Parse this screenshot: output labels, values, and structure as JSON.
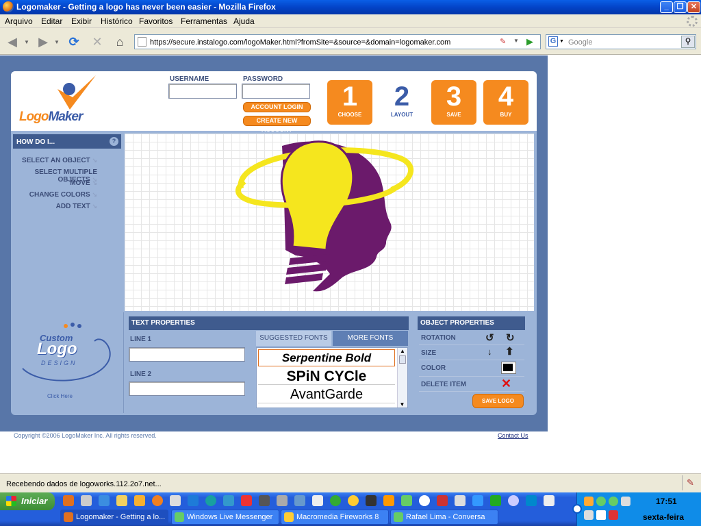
{
  "window": {
    "title": "Logomaker - Getting a logo has never been easier - Mozilla Firefox"
  },
  "menu": [
    "Arquivo",
    "Editar",
    "Exibir",
    "Histórico",
    "Favoritos",
    "Ferramentas",
    "Ajuda"
  ],
  "nav": {
    "url": "https://secure.instalogo.com/logoMaker.html?fromSite=&source=&domain=logomaker.com",
    "search_placeholder": "Google"
  },
  "logomaker": {
    "brand_logo": "LogoMaker",
    "username_label": "USERNAME",
    "password_label": "PASSWORD",
    "username_value": "",
    "password_value": "",
    "account_login": "ACCOUNT LOGIN",
    "create_account": "CREATE NEW ACCOUNT",
    "steps": [
      {
        "num": "1",
        "label": "CHOOSE"
      },
      {
        "num": "2",
        "label": "LAYOUT"
      },
      {
        "num": "3",
        "label": "SAVE"
      },
      {
        "num": "4",
        "label": "BUY"
      }
    ],
    "how_do_i": "HOW DO I...",
    "help_icon": "?",
    "how_items": [
      "SELECT AN OBJECT",
      "SELECT MULTIPLE OBJECTS",
      "MOVE",
      "CHANGE COLORS",
      "ADD TEXT"
    ],
    "custom_logo": {
      "line1": "Custom",
      "line2": "Logo",
      "line3": "DESIGN",
      "click": "Click Here"
    },
    "text_properties": {
      "title": "TEXT PROPERTIES",
      "line1_label": "LINE 1",
      "line2_label": "LINE 2",
      "line1_value": "",
      "line2_value": ""
    },
    "fonts": {
      "tab_suggested": "SUGGESTED FONTS",
      "tab_more": "MORE FONTS",
      "items": [
        "Serpentine Bold",
        "SPiN CYCle",
        "AvantGarde"
      ]
    },
    "object_properties": {
      "title": "OBJECT PROPERTIES",
      "rotation": "ROTATION",
      "size": "SIZE",
      "color": "COLOR",
      "delete": "DELETE ITEM",
      "save_logo": "SAVE LOGO",
      "current_color": "#000000"
    },
    "canvas_colors": {
      "bulb": "#f5e61e",
      "head": "#6b1a6b"
    }
  },
  "footer": {
    "copyright": "Copyright ©2006 LogoMaker Inc. All rights reserved.",
    "contact": "Contact Us"
  },
  "status": "Recebendo dados de logoworks.112.2o7.net...",
  "taskbar": {
    "start": "Iniciar",
    "tasks": [
      "Logomaker - Getting a lo...",
      "Windows Live Messenger",
      "Macromedia Fireworks 8",
      "Rafael Lima - Conversa"
    ],
    "time": "17:51",
    "day": "sexta-feira"
  }
}
